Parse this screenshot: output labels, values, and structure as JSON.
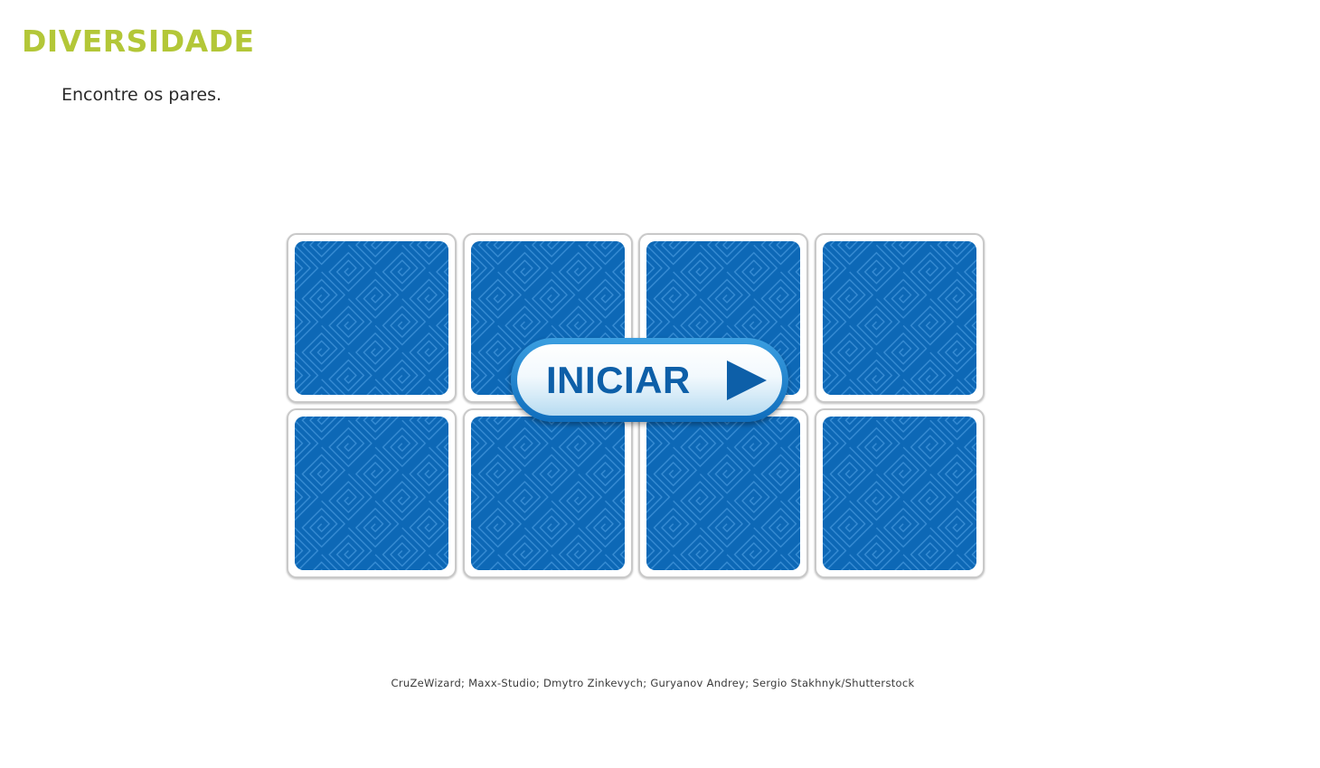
{
  "activity": {
    "title": "DIVERSIDADE",
    "instructions": "Encontre os pares."
  },
  "board": {
    "rows": 2,
    "columns": 4,
    "cards": [
      {
        "state": "face-down"
      },
      {
        "state": "face-down"
      },
      {
        "state": "face-down"
      },
      {
        "state": "face-down"
      },
      {
        "state": "face-down"
      },
      {
        "state": "face-down"
      },
      {
        "state": "face-down"
      },
      {
        "state": "face-down"
      }
    ]
  },
  "start_button": {
    "label": "INICIAR",
    "icon": "play-icon"
  },
  "credits": "CruZeWizard; Maxx-Studio; Dmytro Zinkevych; Guryanov Andrey; Sergio Stakhnyk/Shutterstock",
  "colors": {
    "title": "#b3c738",
    "card_back": "#0d68b6",
    "card_pattern": "#3b8fd6",
    "card_border": "#c9c9c9",
    "button_text": "#0d5fa8",
    "button_rim": "#1273c2"
  }
}
